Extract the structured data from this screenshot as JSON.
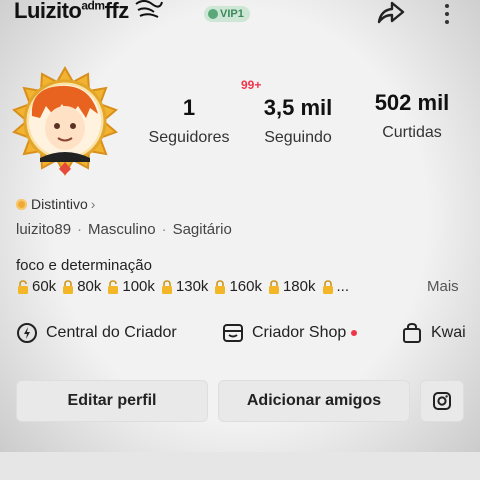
{
  "header": {
    "username": "Luizito",
    "username_sup": "adm",
    "username_suffix": "ffz",
    "vip_label": "VIP1",
    "share_icon": "share-icon",
    "more_icon": "more-vertical-icon"
  },
  "avatar": {
    "icon": "avatar-anime-orange-hair"
  },
  "stats": {
    "seguidores": {
      "value": "1",
      "label": "Seguidores"
    },
    "seguindo": {
      "value": "3,5 mil",
      "label": "Seguindo",
      "badge": "99+"
    },
    "curtidas": {
      "value": "502 mil",
      "label": "Curtidas"
    }
  },
  "profile": {
    "distintivo": "Distintivo",
    "handle": "luizito89",
    "gender": "Masculino",
    "sign": "Sagitário",
    "bio": "foco e determinação",
    "lock_values": [
      "60k",
      "80k",
      "100k",
      "130k",
      "160k",
      "180k",
      "..."
    ],
    "more_label": "Mais"
  },
  "shortcuts": {
    "central": "Central do Criador",
    "shop": "Criador Shop",
    "kwai": "Kwai"
  },
  "buttons": {
    "edit": "Editar perfil",
    "add_friends": "Adicionar amigos",
    "instagram_icon": "instagram-icon"
  },
  "colors": {
    "badge_red": "#f0354b",
    "vip_green": "#5aa779",
    "avatar_frame_gold": "#f2b330"
  }
}
